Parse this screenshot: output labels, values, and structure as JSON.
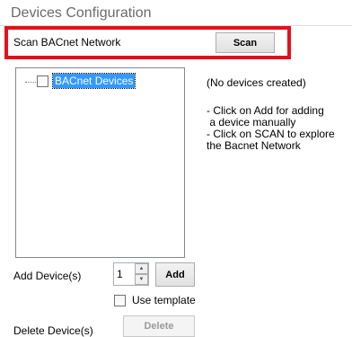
{
  "header": {
    "title": "Devices Configuration"
  },
  "scan": {
    "label": "Scan BACnet Network",
    "button": "Scan"
  },
  "tree": {
    "root_label": "BACnet Devices"
  },
  "info": {
    "empty": "(No devices created)",
    "hint": "- Click on Add for adding\n a device manually\n- Click on SCAN to explore\nthe Bacnet Network"
  },
  "add": {
    "label": "Add Device(s)",
    "quantity": "1",
    "button": "Add",
    "template_label": "Use template",
    "template_checked": false
  },
  "delete": {
    "label": "Delete Device(s)",
    "button": "Delete",
    "enabled": false
  },
  "colors": {
    "highlight": "#e3101c",
    "selection": "#3399ff"
  },
  "icons": {
    "spinner_up": "up-arrow-icon",
    "spinner_down": "down-arrow-icon",
    "tree_connector": "tree-dotted-line"
  }
}
